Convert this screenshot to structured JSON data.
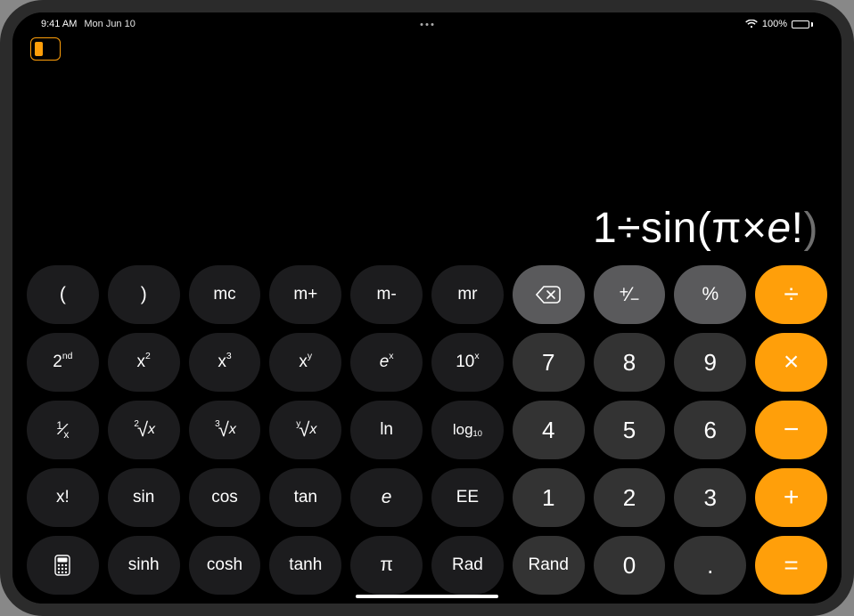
{
  "status": {
    "time": "9:41 AM",
    "date": "Mon Jun 10",
    "battery_pct": "100%"
  },
  "display": {
    "expr_html": "1÷sin(π×<span class=\"ital\">e</span>!<span class=\"dim\">)</span>"
  },
  "keys": {
    "r0": {
      "lparen": "(",
      "rparen": ")",
      "mc": "mc",
      "mplus": "m+",
      "mminus": "m-",
      "mr": "mr",
      "plusminus": "+⁄−",
      "percent": "%",
      "divide": "÷"
    },
    "r1": {
      "second_html": "2<sup>nd</sup>",
      "x2_html": "x<sup>2</sup>",
      "x3_html": "x<sup>3</sup>",
      "xy_html": "x<sup>y</sup>",
      "ex_html": "<span class=\"it\">e</span><sup>x</sup>",
      "tenx_html": "10<sup>x</sup>",
      "n7": "7",
      "n8": "8",
      "n9": "9",
      "mult": "×"
    },
    "r2": {
      "inv_html": "<span class=\"frac\"><span class=\"n\">1</span><span class=\"s\">⁄</span><span class=\"d\">x</span></span>",
      "sqrt_html": "<span class=\"root\"><span class=\"idx\">2</span><span class=\"rad\">√</span><span class=\"arg\">x</span></span>",
      "cbrt_html": "<span class=\"root\"><span class=\"idx\">3</span><span class=\"rad\">√</span><span class=\"arg\">x</span></span>",
      "yroot_html": "<span class=\"root\"><span class=\"idx\">y</span><span class=\"rad\">√</span><span class=\"arg\">x</span></span>",
      "ln": "ln",
      "log10_html": "log<sub>10</sub>",
      "n4": "4",
      "n5": "5",
      "n6": "6",
      "minus": "−"
    },
    "r3": {
      "fact": "x!",
      "sin": "sin",
      "cos": "cos",
      "tan": "tan",
      "e_html": "<span class=\"it\">e</span>",
      "ee": "EE",
      "n1": "1",
      "n2": "2",
      "n3": "3",
      "plus": "+"
    },
    "r4": {
      "sinh": "sinh",
      "cosh": "cosh",
      "tanh": "tanh",
      "pi": "π",
      "rad": "Rad",
      "rand": "Rand",
      "n0": "0",
      "dot": ".",
      "eq": "="
    }
  }
}
